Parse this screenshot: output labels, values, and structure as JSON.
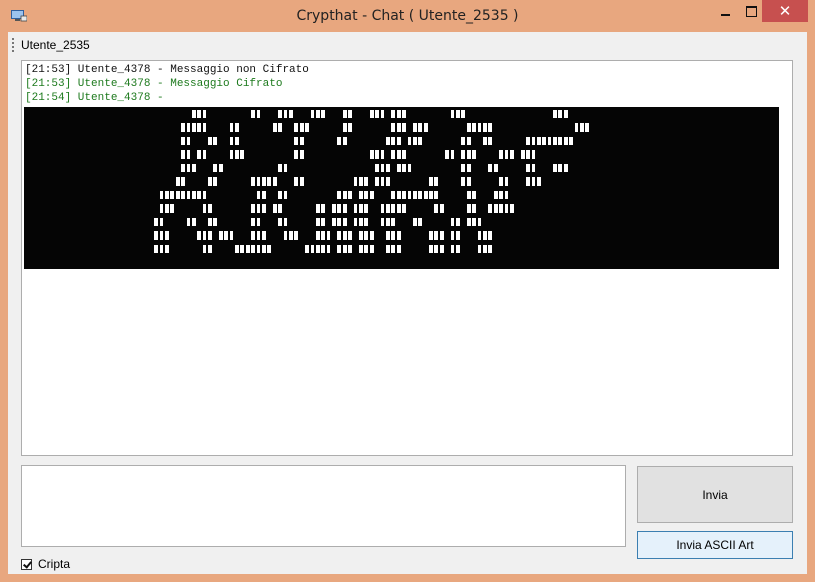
{
  "window": {
    "title": "Crypthat - Chat ( Utente_2535 )",
    "close_glyph": "✕",
    "frame_color": "#e8a77f",
    "close_color": "#c7504f"
  },
  "toolbar": {
    "user": "Utente_2535"
  },
  "chat": {
    "lines": [
      {
        "text": "[21:53] Utente_4378 - Messaggio non Cifrato",
        "style": "plain"
      },
      {
        "text": "[21:53] Utente_4378 - Messaggio Cifrato",
        "style": "cipher"
      },
      {
        "text": "[21:54] Utente_4378 - ",
        "style": "cipher"
      }
    ],
    "ascii_art_rows": [
      "...............................WWW........WW...WWW...WWW...WW...WWW.WWW........WWW................WWW.............................",
      ".............................WWWWW....WW......WW..WWW......WW.......WWW.WWW.......WWWWW...............WWW.........................",
      ".............................WW...WW..WW..........WW......WW.......WWW.WWW.......WW..WW......WWWWWWWWW.........................",
      ".............................WW.WW....WWW.........WW............WWW.WWW.......WW.WWW....WWW.WWW...........................",
      ".............................WWW...WW..........WW................WWW.WWW.........WW...WW.....WW...WWW........................",
      "............................WW....WW......WWWWW...WW.........WWW.WWW.......WW....WW.....WW...WWW..........................",
      ".........................WWWWWWWWW.........WW..WW.........WWW.WWW...WWWWWWWWW.....WW...WWW..............................",
      ".........................WWW.....WW.......WWW.WW......WW.WWW.WWW..WWWWW.....WW....WW..WWWWW...........................",
      "........................WW....WW..WW......WW...WW.....WW.WWW.WWW..WWW...WW.....WW.WWW.............................",
      "........................WWW.....WWW.WWW...WWW...WWW...WWW.WWW.WWW..WWW.....WWW.WW...WWW...........................",
      "........................WWW......WW....WWWWWWW......WWWWW.WWW.WWW..WWW.....WWW.WW...WWW...........................",
      ".............................................................................................................................."
    ]
  },
  "input": {
    "value": "",
    "placeholder": ""
  },
  "buttons": {
    "send": "Invia",
    "ascii": "Invia ASCII Art"
  },
  "encrypt": {
    "label": "Cripta",
    "checked": true
  }
}
